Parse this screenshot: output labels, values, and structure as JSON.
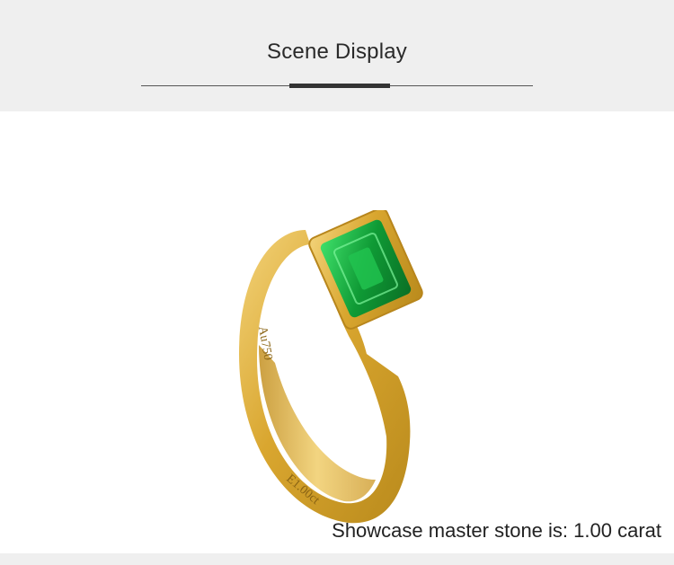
{
  "header": {
    "title": "Scene Display"
  },
  "product": {
    "engraving_metal": "Au750",
    "engraving_weight": "E1.00ct",
    "caption": "Showcase master stone is: 1.00 carat",
    "image": "gold-ring-with-green-emerald-cut-stone"
  },
  "colors": {
    "gold": "#d4a52a",
    "stone": "#12a83c",
    "header_bg": "#efefef"
  }
}
